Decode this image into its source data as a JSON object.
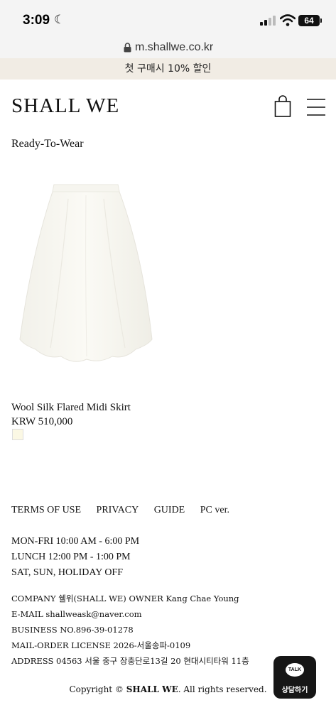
{
  "status_bar": {
    "time": "3:09",
    "battery": "64"
  },
  "browser": {
    "url": "m.shallwe.co.kr"
  },
  "promo": {
    "text": "첫 구매시 10% 할인"
  },
  "header": {
    "logo": "SHALL WE"
  },
  "section": {
    "title": "Ready-To-Wear"
  },
  "product": {
    "name": "Wool Silk Flared Midi Skirt",
    "price": "KRW 510,000",
    "swatch_color": "#fbf8e4"
  },
  "footer": {
    "links": [
      "TERMS OF USE",
      "PRIVACY",
      "GUIDE",
      "PC ver."
    ],
    "hours": [
      "MON-FRI 10:00 AM - 6:00 PM",
      "LUNCH 12:00 PM - 1:00 PM",
      "SAT, SUN, HOLIDAY OFF"
    ],
    "info": [
      "COMPANY 쉘위(SHALL WE) OWNER Kang Chae Young",
      "E-MAIL shallweask@naver.com",
      "BUSINESS NO.896-39-01278",
      "MAIL-ORDER LICENSE 2026-서울송파-0109",
      "ADDRESS 04563 서울 중구 장충단로13길 20 현대시티타워 11층"
    ],
    "copyright_prefix": "Copyright © ",
    "copyright_brand": "SHALL WE",
    "copyright_suffix": ". All rights reserved."
  },
  "chat": {
    "bubble": "TALK",
    "label": "상담하기"
  }
}
